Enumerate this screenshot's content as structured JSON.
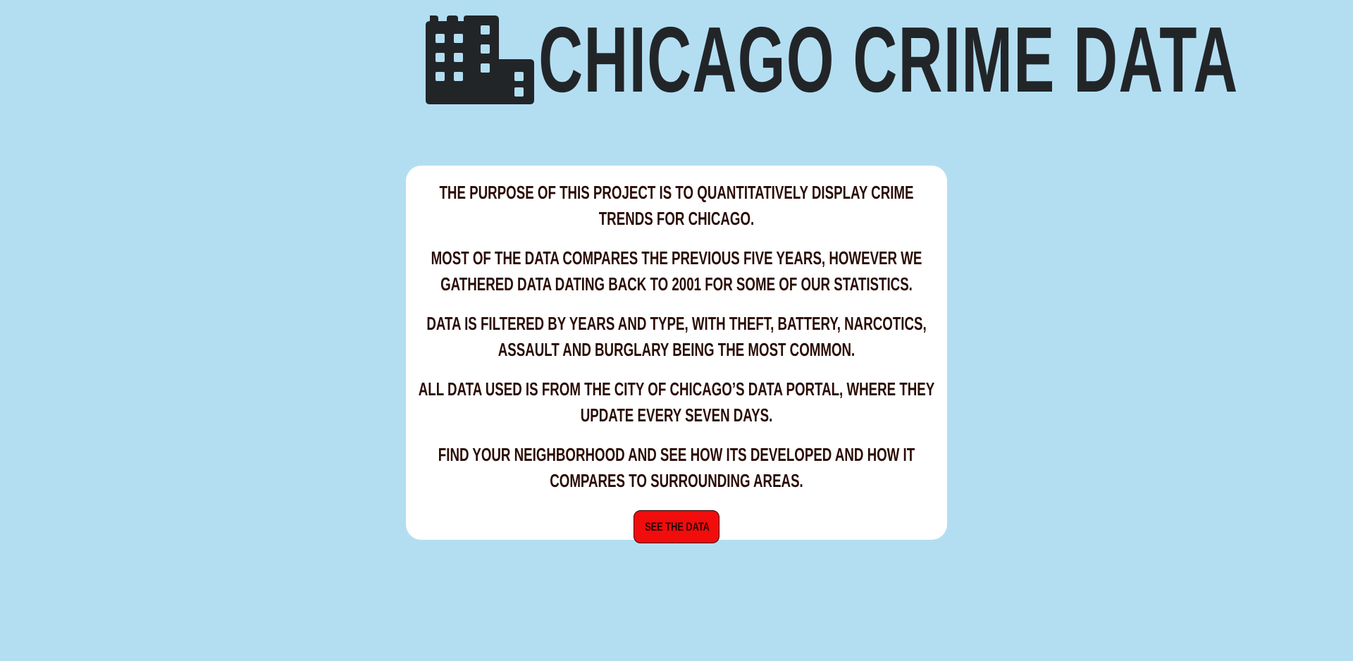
{
  "header": {
    "title": "CHICAGO CRIME DATA",
    "icon": "city-buildings-icon",
    "color": "#222528"
  },
  "page": {
    "background": "#b3def2"
  },
  "card": {
    "paragraphs": [
      "THE PURPOSE OF THIS PROJECT IS TO QUANTITATIVELY DISPLAY CRIME TRENDS FOR CHICAGO.",
      "MOST OF THE DATA COMPARES THE PREVIOUS FIVE YEARS, HOWEVER WE GATHERED DATA DATING BACK TO 2001 FOR SOME OF OUR STATISTICS.",
      "DATA IS FILTERED BY YEARS AND TYPE, WITH THEFT, BATTERY, NARCOTICS, ASSAULT AND BURGLARY BEING THE MOST COMMON.",
      "ALL DATA USED IS FROM THE CITY OF CHICAGO’S DATA PORTAL, WHERE THEY UPDATE EVERY SEVEN DAYS.",
      "FIND YOUR NEIGHBORHOOD AND SEE HOW ITS DEVELOPED AND HOW IT COMPARES TO SURROUNDING AREAS."
    ],
    "button_label": "SEE THE DATA",
    "button_color": "#f20c0c"
  }
}
